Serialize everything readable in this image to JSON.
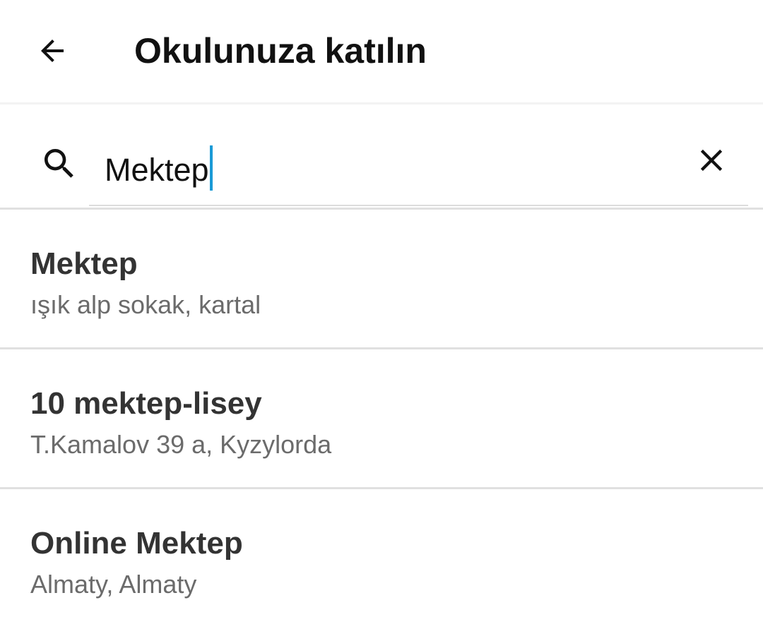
{
  "header": {
    "title": "Okulunuza katılın",
    "back_icon": "arrow-left-icon"
  },
  "search": {
    "value": "Mektep",
    "icon": "search-icon",
    "clear_icon": "close-icon",
    "caret_color": "#1a9ad6"
  },
  "results": [
    {
      "name": "Mektep",
      "address": "ışık alp sokak, kartal"
    },
    {
      "name": "10 mektep-lisey",
      "address": "T.Kamalov 39 a, Kyzylorda"
    },
    {
      "name": "Online Mektep",
      "address": "Almaty, Almaty"
    }
  ]
}
